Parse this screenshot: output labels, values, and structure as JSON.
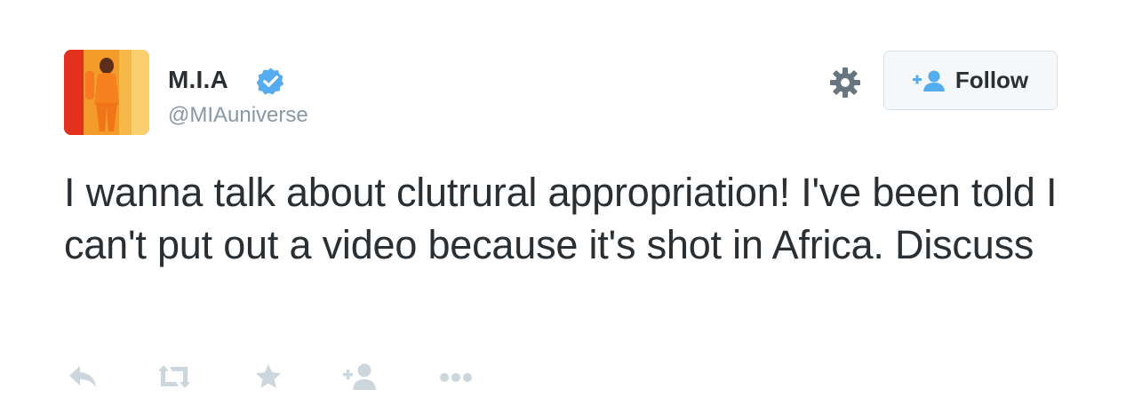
{
  "user": {
    "display_name": "M.I.A",
    "handle": "@MIAuniverse",
    "verified": true,
    "verified_icon": "verified-badge-icon",
    "verified_color": "#55acee"
  },
  "header": {
    "settings_icon": "gear-icon",
    "follow_label": "Follow",
    "follow_icon": "follow-user-plus-icon"
  },
  "tweet": {
    "text": "I wanna talk about clutrural appropriation! I've been told I can't put out a video because it's shot in Africa. Discuss"
  },
  "actions": [
    {
      "name": "reply",
      "icon": "reply-icon"
    },
    {
      "name": "retweet",
      "icon": "retweet-icon"
    },
    {
      "name": "favorite",
      "icon": "star-icon"
    },
    {
      "name": "follow",
      "icon": "user-plus-icon"
    },
    {
      "name": "more",
      "icon": "more-dots-icon"
    }
  ],
  "colors": {
    "text": "#292f33",
    "muted": "#8899a6",
    "action_icon": "#ccd6dd",
    "button_bg": "#f5f8fa",
    "button_border": "#d9e2e9",
    "brand_blue": "#55acee"
  }
}
